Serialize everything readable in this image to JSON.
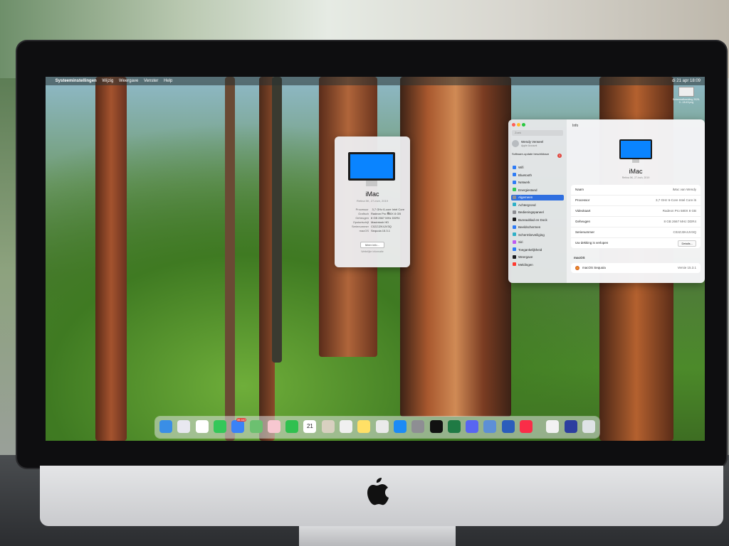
{
  "menubar": {
    "apple": "",
    "app_name": "Systeeminstellingen",
    "menus": [
      "Wijzig",
      "Weergave",
      "Venster",
      "Help"
    ],
    "clock": "di 21 apr 18:09"
  },
  "about_window": {
    "model": "iMac",
    "subtitle": "Retina 5K, 27-inch, 2019",
    "specs": [
      {
        "label": "Processor",
        "value": "3,7 GHz 6-core Intel Core i5"
      },
      {
        "label": "Grafisch",
        "value": "Radeon Pro 580X 8 GB"
      },
      {
        "label": "Geheugen",
        "value": "8 GB 2667 MHz DDR4"
      },
      {
        "label": "Opstartschijf",
        "value": "Macintosh HD"
      },
      {
        "label": "Serienummer",
        "value": "C02ZJ2K4JV3Q"
      },
      {
        "label": "macOS",
        "value": "Sequoia 15.3.1"
      }
    ],
    "more_info_button": "Meer info...",
    "legal": "Wettelijke informatie"
  },
  "settings_window": {
    "header_title": "Info",
    "search_placeholder": "Zoek",
    "user_name": "Wendy Verweel",
    "user_subtitle": "Apple Account",
    "software_update": "Software-update beschikbaar",
    "update_badge": "1",
    "sidebar_items": [
      {
        "label": "Wifi",
        "color": "#2f7cf6"
      },
      {
        "label": "Bluetooth",
        "color": "#2f7cf6"
      },
      {
        "label": "Netwerk",
        "color": "#2f7cf6"
      },
      {
        "label": "Energiestand",
        "color": "#34c759"
      },
      {
        "label": "Algemeen",
        "color": "#8e8e93",
        "active": true
      },
      {
        "label": "Achtergrond",
        "color": "#30b0c7"
      },
      {
        "label": "Bedieningspaneel",
        "color": "#8e8e93"
      },
      {
        "label": "Bureaublad en Dock",
        "color": "#1c1c1e"
      },
      {
        "label": "Beeldschermen",
        "color": "#2f7cf6"
      },
      {
        "label": "Schermbeveiliging",
        "color": "#30b0c7"
      },
      {
        "label": "Siri",
        "color": "#bf5af2"
      },
      {
        "label": "Toegankelijkheid",
        "color": "#2f7cf6"
      },
      {
        "label": "Weergave",
        "color": "#1c1c1e"
      },
      {
        "label": "Meldingen",
        "color": "#ff3b30"
      }
    ],
    "model": "iMac",
    "subtitle": "Retina 5K, 27-inch, 2019",
    "info_rows": [
      {
        "key": "Naam",
        "value": "iMac van Wendy"
      },
      {
        "key": "Processor",
        "value": "3,7 GHz 6-Core Intel Core i5"
      },
      {
        "key": "Videokaart",
        "value": "Radeon Pro 580X 8 GB"
      },
      {
        "key": "Geheugen",
        "value": "8 GB 2667 MHz DDR4"
      },
      {
        "key": "Serienummer",
        "value": "C02ZJ2K4JV3Q"
      },
      {
        "key": "Uw dekking is verlopen",
        "button": "Details..."
      }
    ],
    "macos_section": "macOS",
    "macos_name": "macOS Sequoia",
    "macos_version": "Versie 15.3.1"
  },
  "desktop_widget": {
    "label": "Schermafbeelding 2025-0...18.43.png"
  },
  "dock": {
    "apps": [
      {
        "name": "finder",
        "color": "#3a8ee6"
      },
      {
        "name": "launchpad",
        "color": "#e8e8f0"
      },
      {
        "name": "chrome",
        "color": "#ffffff"
      },
      {
        "name": "messages",
        "color": "#34c759"
      },
      {
        "name": "mail",
        "color": "#3b82f6",
        "badge": "39.447"
      },
      {
        "name": "maps",
        "color": "#6cc070"
      },
      {
        "name": "photos",
        "color": "#f7c7d0"
      },
      {
        "name": "facetime",
        "color": "#30c04f"
      },
      {
        "name": "calendar",
        "color": "#ffffff",
        "text": "21"
      },
      {
        "name": "contacts",
        "color": "#d8d0c0"
      },
      {
        "name": "freeform",
        "color": "#f0f0f0"
      },
      {
        "name": "notes",
        "color": "#ffe066"
      },
      {
        "name": "rotating-app",
        "color": "#eaeaea"
      },
      {
        "name": "app-store",
        "color": "#1c8bf5"
      },
      {
        "name": "system-settings",
        "color": "#8e8e93"
      },
      {
        "name": "capture",
        "color": "#111111"
      },
      {
        "name": "excel",
        "color": "#1f7a44"
      },
      {
        "name": "discord",
        "color": "#5865f2"
      },
      {
        "name": "screen-share",
        "color": "#5d8fd6"
      },
      {
        "name": "word",
        "color": "#2b5dbb"
      },
      {
        "name": "music",
        "color": "#fa2d48"
      },
      {
        "name": "downloads",
        "color": "#f2f2f2"
      },
      {
        "name": "eu-folder",
        "color": "#2c3e9f"
      },
      {
        "name": "trash",
        "color": "#dfe3e6"
      }
    ]
  }
}
